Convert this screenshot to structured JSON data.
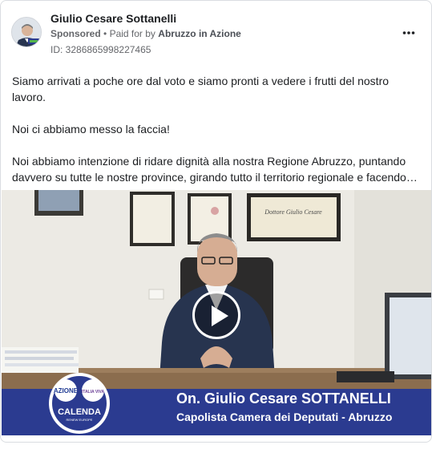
{
  "post": {
    "author_name": "Giulio Cesare Sottanelli",
    "sponsored_label": "Sponsored",
    "separator": "•",
    "paid_for_by_label": "Paid for by",
    "payer_name": "Abruzzo in Azione",
    "ad_id_label": "ID: 3286865998227465",
    "more_icon": "more-horizontal-icon",
    "body_paragraphs": [
      "Siamo arrivati a poche ore dal voto e siamo pronti a vedere i frutti del nostro lavoro.",
      "Noi ci abbiamo messo la faccia!",
      "Noi abbiamo intenzione di ridare dignità alla nostra Regione Abruzzo, puntando davvero su tutte le nostre province, girando tutto il territorio regionale e facendo…"
    ]
  },
  "video": {
    "play_icon": "play-icon",
    "banner_name_prefix": "On. Giulio Cesare ",
    "banner_surname": "SOTTANELLI",
    "banner_role": "Capolista Camera dei Deputati - Abruzzo",
    "logo_top_left": "AZIONE",
    "logo_top_right": "ITALIA VIVA",
    "logo_bottom": "CALENDA",
    "logo_tagline": "RENEW EUROPE",
    "diploma_script": "Dottore Giulio Cesare"
  },
  "colors": {
    "banner_blue": "#2b3b90",
    "wall": "#eceae4",
    "text_primary": "#1c1e21",
    "text_secondary": "#65676b"
  }
}
